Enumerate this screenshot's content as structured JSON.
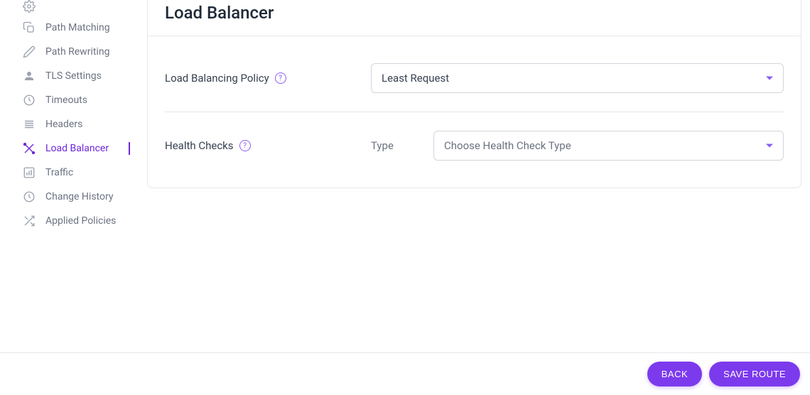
{
  "sidebar": {
    "items": [
      {
        "label": "Path Matching",
        "active": false,
        "icon": "copy"
      },
      {
        "label": "Path Rewriting",
        "active": false,
        "icon": "pencil"
      },
      {
        "label": "TLS Settings",
        "active": false,
        "icon": "user"
      },
      {
        "label": "Timeouts",
        "active": false,
        "icon": "clock"
      },
      {
        "label": "Headers",
        "active": false,
        "icon": "lines"
      },
      {
        "label": "Load Balancer",
        "active": true,
        "icon": "cross-tools"
      },
      {
        "label": "Traffic",
        "active": false,
        "icon": "chart"
      },
      {
        "label": "Change History",
        "active": false,
        "icon": "clock"
      },
      {
        "label": "Applied Policies",
        "active": false,
        "icon": "shuffle"
      }
    ]
  },
  "page": {
    "title": "Load Balancer",
    "lb_policy": {
      "label": "Load Balancing Policy",
      "value": "Least Request"
    },
    "health_checks": {
      "label": "Health Checks",
      "type_label": "Type",
      "type_placeholder": "Choose Health Check Type"
    }
  },
  "footer": {
    "back": "BACK",
    "save": "SAVE ROUTE"
  }
}
